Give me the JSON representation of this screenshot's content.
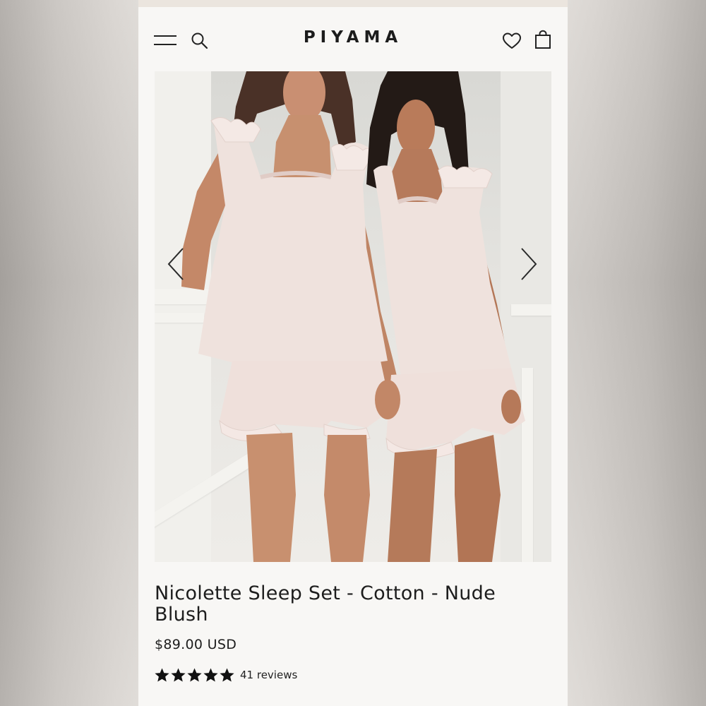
{
  "store": {
    "brand": "PIYAMA"
  },
  "header": {
    "icons": [
      "menu-icon",
      "search-icon",
      "heart-icon",
      "shopping-bag-icon"
    ]
  },
  "gallery": {
    "prev_icon": "chevron-left-icon",
    "next_icon": "chevron-right-icon"
  },
  "product": {
    "title": "Nicolette Sleep Set - Cotton - Nude Blush",
    "price": "$89.00 USD",
    "rating": 5,
    "rating_max": 5,
    "reviews": "41 reviews"
  },
  "colors": {
    "background": "#f8f7f5",
    "text": "#1d1d1d",
    "accent_bar": "#ebe5de",
    "garment": "#efe2dd"
  }
}
